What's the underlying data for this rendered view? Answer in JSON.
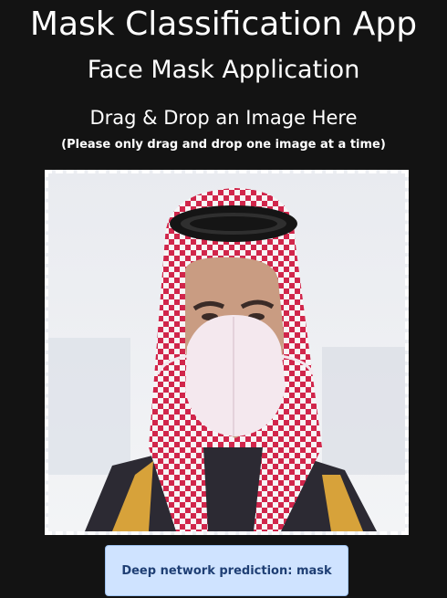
{
  "header": {
    "title": "Mask Classification App",
    "subtitle": "Face Mask Application"
  },
  "drop_zone": {
    "title": "Drag & Drop an Image Here",
    "note": "(Please only drag and drop one image at a time)",
    "image_icon": "uploaded-image"
  },
  "prediction": {
    "label": "Deep network prediction: mask"
  },
  "colors": {
    "background": "#131313",
    "text": "#ffffff",
    "drop_border": "#ffffff",
    "prediction_bg": "#cfe3ff",
    "prediction_text": "#1f3f74"
  }
}
